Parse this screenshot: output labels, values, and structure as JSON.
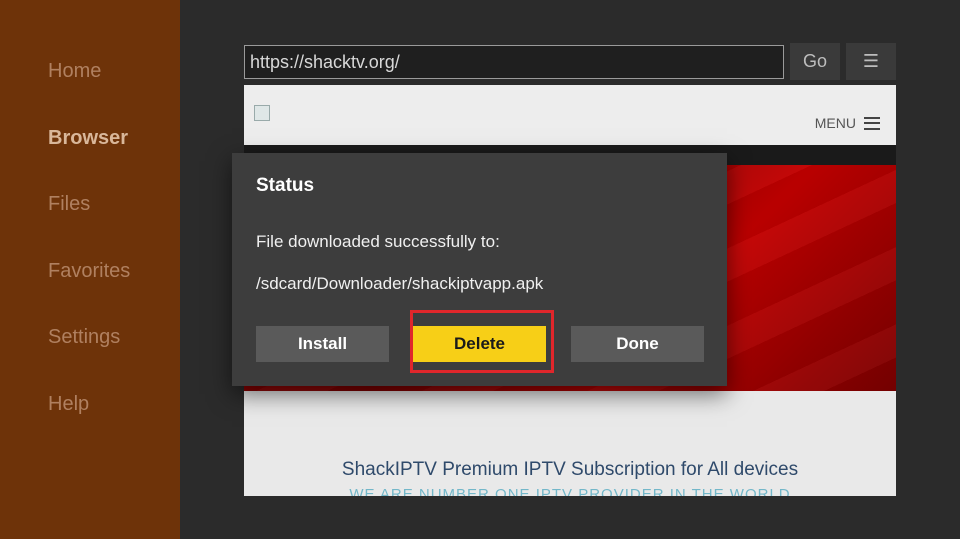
{
  "sidebar": {
    "items": [
      {
        "label": "Home"
      },
      {
        "label": "Browser"
      },
      {
        "label": "Files"
      },
      {
        "label": "Favorites"
      },
      {
        "label": "Settings"
      },
      {
        "label": "Help"
      }
    ],
    "active": "Browser"
  },
  "browser": {
    "url": "https://shacktv.org/",
    "go_label": "Go",
    "menu_glyph": "☰"
  },
  "site": {
    "menu_label": "MENU",
    "title": "ShackIPTV Premium IPTV Subscription for All devices",
    "subtitle": "WE ARE NUMBER ONE IPTV PROVIDER IN THE WORLD"
  },
  "dialog": {
    "title": "Status",
    "message": "File downloaded successfully to:",
    "path": "/sdcard/Downloader/shackiptvapp.apk",
    "buttons": {
      "install": "Install",
      "delete": "Delete",
      "done": "Done"
    },
    "focused_button": "Delete"
  },
  "colors": {
    "sidebar": "#6e3309",
    "focus_button": "#f7cf17",
    "highlight_ring": "#e0262b"
  }
}
